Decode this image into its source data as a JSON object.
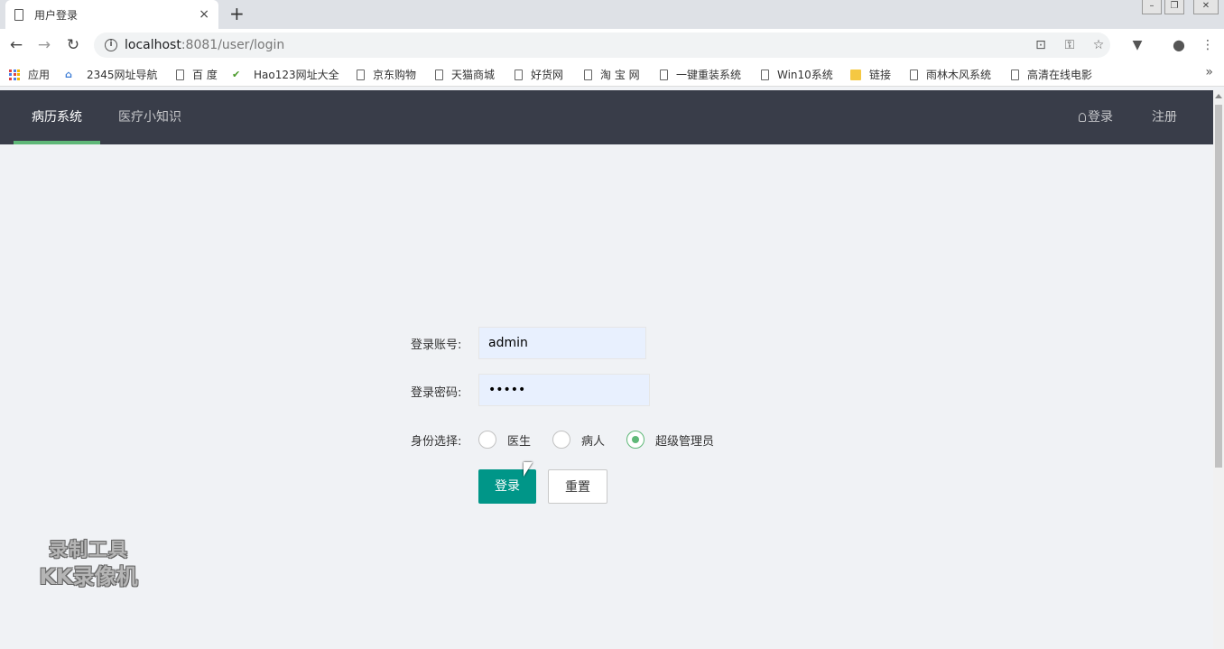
{
  "browser": {
    "tab_title": "用户登录",
    "tab_close": "×",
    "new_tab": "+",
    "url_host": "localhost",
    "url_rest": ":8081/user/login",
    "bookmarks": [
      {
        "label": "应用",
        "icon": "apps-icon"
      },
      {
        "label": "2345网址导航",
        "icon": "2345-icon"
      },
      {
        "label": "百 度",
        "icon": "page-icon"
      },
      {
        "label": "Hao123网址大全",
        "icon": "hao123-icon"
      },
      {
        "label": "京东购物",
        "icon": "page-icon"
      },
      {
        "label": "天猫商城",
        "icon": "page-icon"
      },
      {
        "label": "好货网",
        "icon": "page-icon"
      },
      {
        "label": "淘 宝 网",
        "icon": "page-icon"
      },
      {
        "label": "一键重装系统",
        "icon": "page-icon"
      },
      {
        "label": "Win10系统",
        "icon": "page-icon"
      },
      {
        "label": "链接",
        "icon": "folder-icon"
      },
      {
        "label": "雨林木风系统",
        "icon": "page-icon"
      },
      {
        "label": "高清在线电影",
        "icon": "page-icon"
      }
    ],
    "more": "»"
  },
  "nav": {
    "items": [
      "病历系统",
      "医疗小知识"
    ],
    "login": "登录",
    "register": "注册"
  },
  "form": {
    "account_label": "登录账号:",
    "account_value": "admin",
    "password_label": "登录密码:",
    "password_value": "•••••",
    "role_label": "身份选择:",
    "roles": [
      "医生",
      "病人",
      "超级管理员"
    ],
    "selected_role": "超级管理员",
    "submit": "登录",
    "reset": "重置"
  },
  "watermark": {
    "line1": "录制工具",
    "line2": "KK录像机"
  },
  "colors": {
    "nav_bg": "#393d49",
    "nav_accent": "#5fb878",
    "primary": "#009688",
    "page_bg": "#f0f2f5"
  }
}
